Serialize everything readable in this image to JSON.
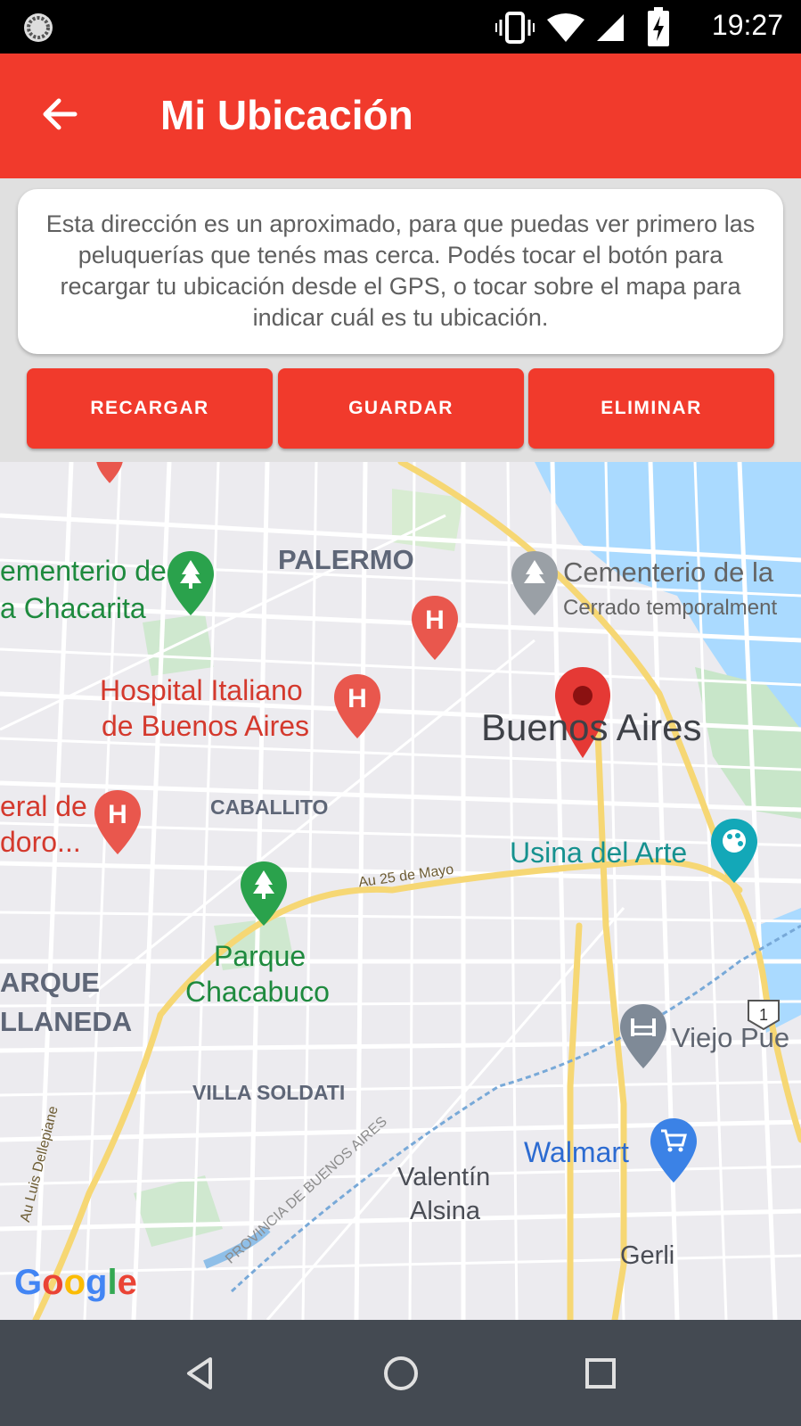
{
  "status_bar": {
    "time": "19:27",
    "icons": [
      "notification-icon",
      "vibrate-icon",
      "wifi-icon",
      "signal-icon",
      "battery-charging-icon"
    ]
  },
  "app_bar": {
    "title": "Mi Ubicación",
    "back_icon": "arrow-back-icon",
    "color": "#f13a2c"
  },
  "info_card": {
    "text": "Esta dirección es un aproximado, para que puedas ver primero las peluquerías que tenés mas cerca. Podés tocar el botón para recargar tu ubicación desde el GPS, o tocar sobre el mapa para indicar cuál es tu ubicación."
  },
  "buttons": {
    "reload": "RECARGAR",
    "save": "GUARDAR",
    "delete": "ELIMINAR"
  },
  "map": {
    "labels": {
      "palermo": "PALERMO",
      "caballito": "CABALLITO",
      "villa_soldati": "VILLA SOLDATI",
      "parque_line1": "ARQUE",
      "parque_line2": "LLANEDA",
      "cementerio_left_line1": "ementerio de",
      "cementerio_left_line2": "a Chacarita",
      "hospital_line1": "Hospital Italiano",
      "hospital_line2": "de Buenos Aires",
      "hospital_left_line1": "eral de",
      "hospital_left_line2": "doro...",
      "cementerio_right": "Cementerio de la",
      "cementerio_right_sub": "Cerrado temporalment",
      "city": "Buenos Aires",
      "usina": "Usina del Arte",
      "parque_chacabuco_line1": "Parque",
      "parque_chacabuco_line2": "Chacabuco",
      "viejo_puente": "Viejo Pue",
      "walmart": "Walmart",
      "valentin_line1": "Valentín",
      "valentin_line2": "Alsina",
      "gerli": "Gerli",
      "road_25_mayo": "Au 25 de Mayo",
      "road_dellepiane": "Au Luis Dellepiane",
      "road_provincia": "PROVINCIA DE BUENOS AIRES",
      "route_shield": "1"
    },
    "pins": {
      "selected_location": "location-pin-icon",
      "hospitals": "hospital-icon",
      "parks": "park-icon",
      "cemetery": "cemetery-icon",
      "art": "palette-icon",
      "shopping": "shopping-cart-icon",
      "bridge": "bridge-icon"
    },
    "attribution": "Google"
  },
  "nav_bar": {
    "icons": [
      "back-triangle-icon",
      "home-circle-icon",
      "recents-square-icon"
    ]
  }
}
